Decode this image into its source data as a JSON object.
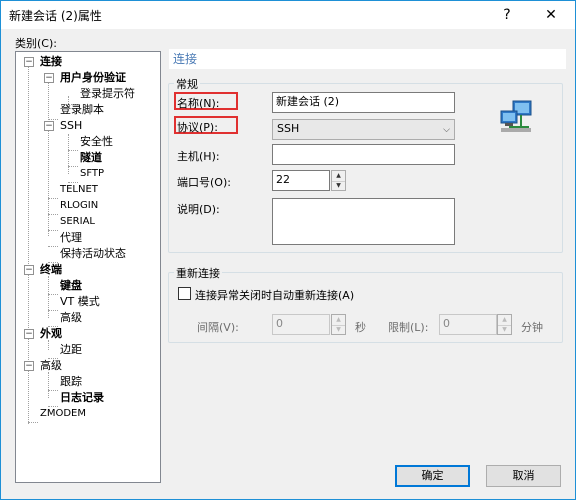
{
  "window": {
    "title": "新建会话 (2)属性",
    "help_icon": "?",
    "close_icon": "✕"
  },
  "category_label": "类别(C):",
  "tree": {
    "connection": "连接",
    "user_auth": "用户身份验证",
    "login_prompts": "登录提示符",
    "login_script": "登录脚本",
    "ssh": "SSH",
    "security": "安全性",
    "tunnel": "隧道",
    "sftp": "SFTP",
    "telnet": "TELNET",
    "rlogin": "RLOGIN",
    "serial": "SERIAL",
    "proxy": "代理",
    "keepalive": "保持活动状态",
    "terminal": "终端",
    "keyboard": "键盘",
    "vt_mode": "VT 模式",
    "terminal_advanced": "高级",
    "appearance": "外观",
    "margin": "边距",
    "advanced": "高级",
    "trace": "跟踪",
    "logging": "日志记录",
    "zmodem": "ZMODEM"
  },
  "panel": {
    "title": "连接",
    "general": {
      "label": "常规",
      "name_label": "名称(N):",
      "name_value": "新建会话 (2)",
      "protocol_label": "协议(P):",
      "protocol_value": "SSH",
      "host_label": "主机(H):",
      "host_value": "",
      "port_label": "端口号(O):",
      "port_value": "22",
      "desc_label": "说明(D):",
      "desc_value": ""
    },
    "reconnect": {
      "label": "重新连接",
      "checkbox_label": "连接异常关闭时自动重新连接(A)",
      "interval_label": "间隔(V):",
      "interval_value": "0",
      "interval_unit": "秒",
      "limit_label": "限制(L):",
      "limit_value": "0",
      "limit_unit": "分钟"
    }
  },
  "buttons": {
    "ok": "确定",
    "cancel": "取消"
  },
  "colors": {
    "accent": "#0078d7",
    "highlight_box": "#e03030",
    "panel_title": "#4a7ab5"
  }
}
